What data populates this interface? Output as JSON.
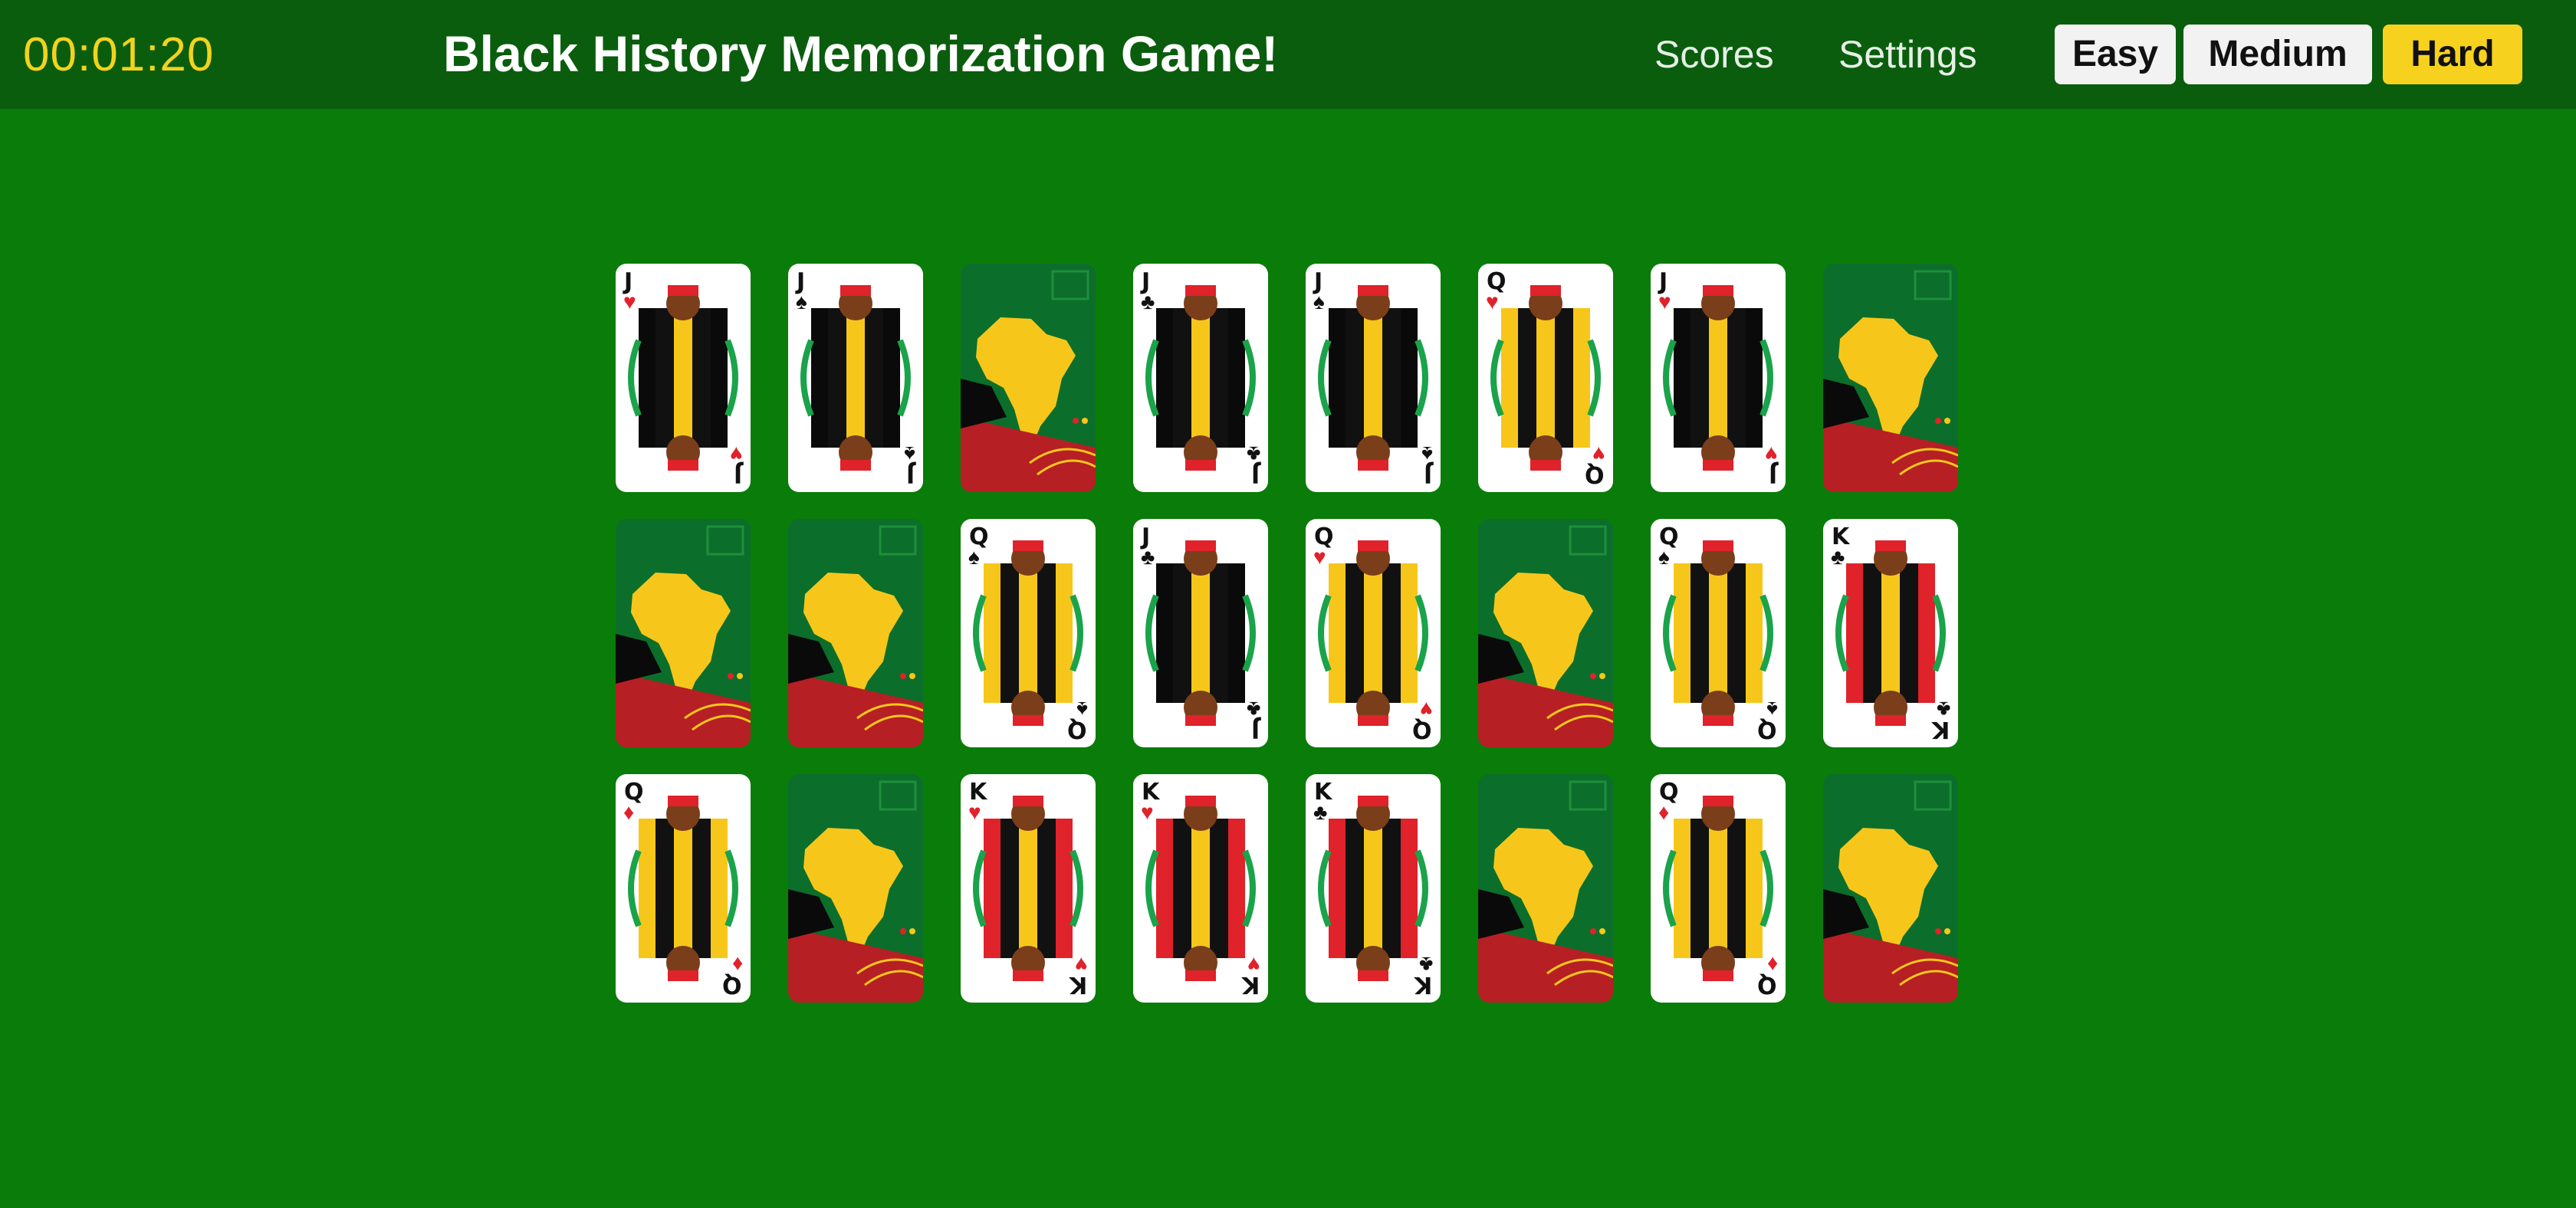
{
  "header": {
    "timer": "00:01:20",
    "title": "Black History Memorization Game!",
    "nav": {
      "scores": "Scores",
      "settings": "Settings"
    },
    "difficulty": {
      "easy": "Easy",
      "medium": "Medium",
      "hard": "Hard",
      "selected": "Hard"
    }
  },
  "colors": {
    "background": "#0a7c09",
    "header": "#0b5d0e",
    "timer": "#f2d31d",
    "selected_button": "#f6d21e",
    "card_back": "#0c6e2b",
    "africa": "#f6c71a"
  },
  "board": {
    "rows": 3,
    "cols": 8,
    "cards": [
      {
        "state": "face",
        "rank": "J",
        "suit": "hearts"
      },
      {
        "state": "face",
        "rank": "J",
        "suit": "spades"
      },
      {
        "state": "back"
      },
      {
        "state": "face",
        "rank": "J",
        "suit": "clubs"
      },
      {
        "state": "face",
        "rank": "J",
        "suit": "spades"
      },
      {
        "state": "face",
        "rank": "Q",
        "suit": "hearts"
      },
      {
        "state": "face",
        "rank": "J",
        "suit": "hearts"
      },
      {
        "state": "back"
      },
      {
        "state": "back"
      },
      {
        "state": "back"
      },
      {
        "state": "face",
        "rank": "Q",
        "suit": "spades"
      },
      {
        "state": "face",
        "rank": "J",
        "suit": "clubs"
      },
      {
        "state": "face",
        "rank": "Q",
        "suit": "hearts"
      },
      {
        "state": "back"
      },
      {
        "state": "face",
        "rank": "Q",
        "suit": "spades"
      },
      {
        "state": "face",
        "rank": "K",
        "suit": "clubs"
      },
      {
        "state": "face",
        "rank": "Q",
        "suit": "diamonds"
      },
      {
        "state": "back"
      },
      {
        "state": "face",
        "rank": "K",
        "suit": "hearts"
      },
      {
        "state": "face",
        "rank": "K",
        "suit": "hearts"
      },
      {
        "state": "face",
        "rank": "K",
        "suit": "clubs"
      },
      {
        "state": "back"
      },
      {
        "state": "face",
        "rank": "Q",
        "suit": "diamonds"
      },
      {
        "state": "back"
      }
    ]
  }
}
